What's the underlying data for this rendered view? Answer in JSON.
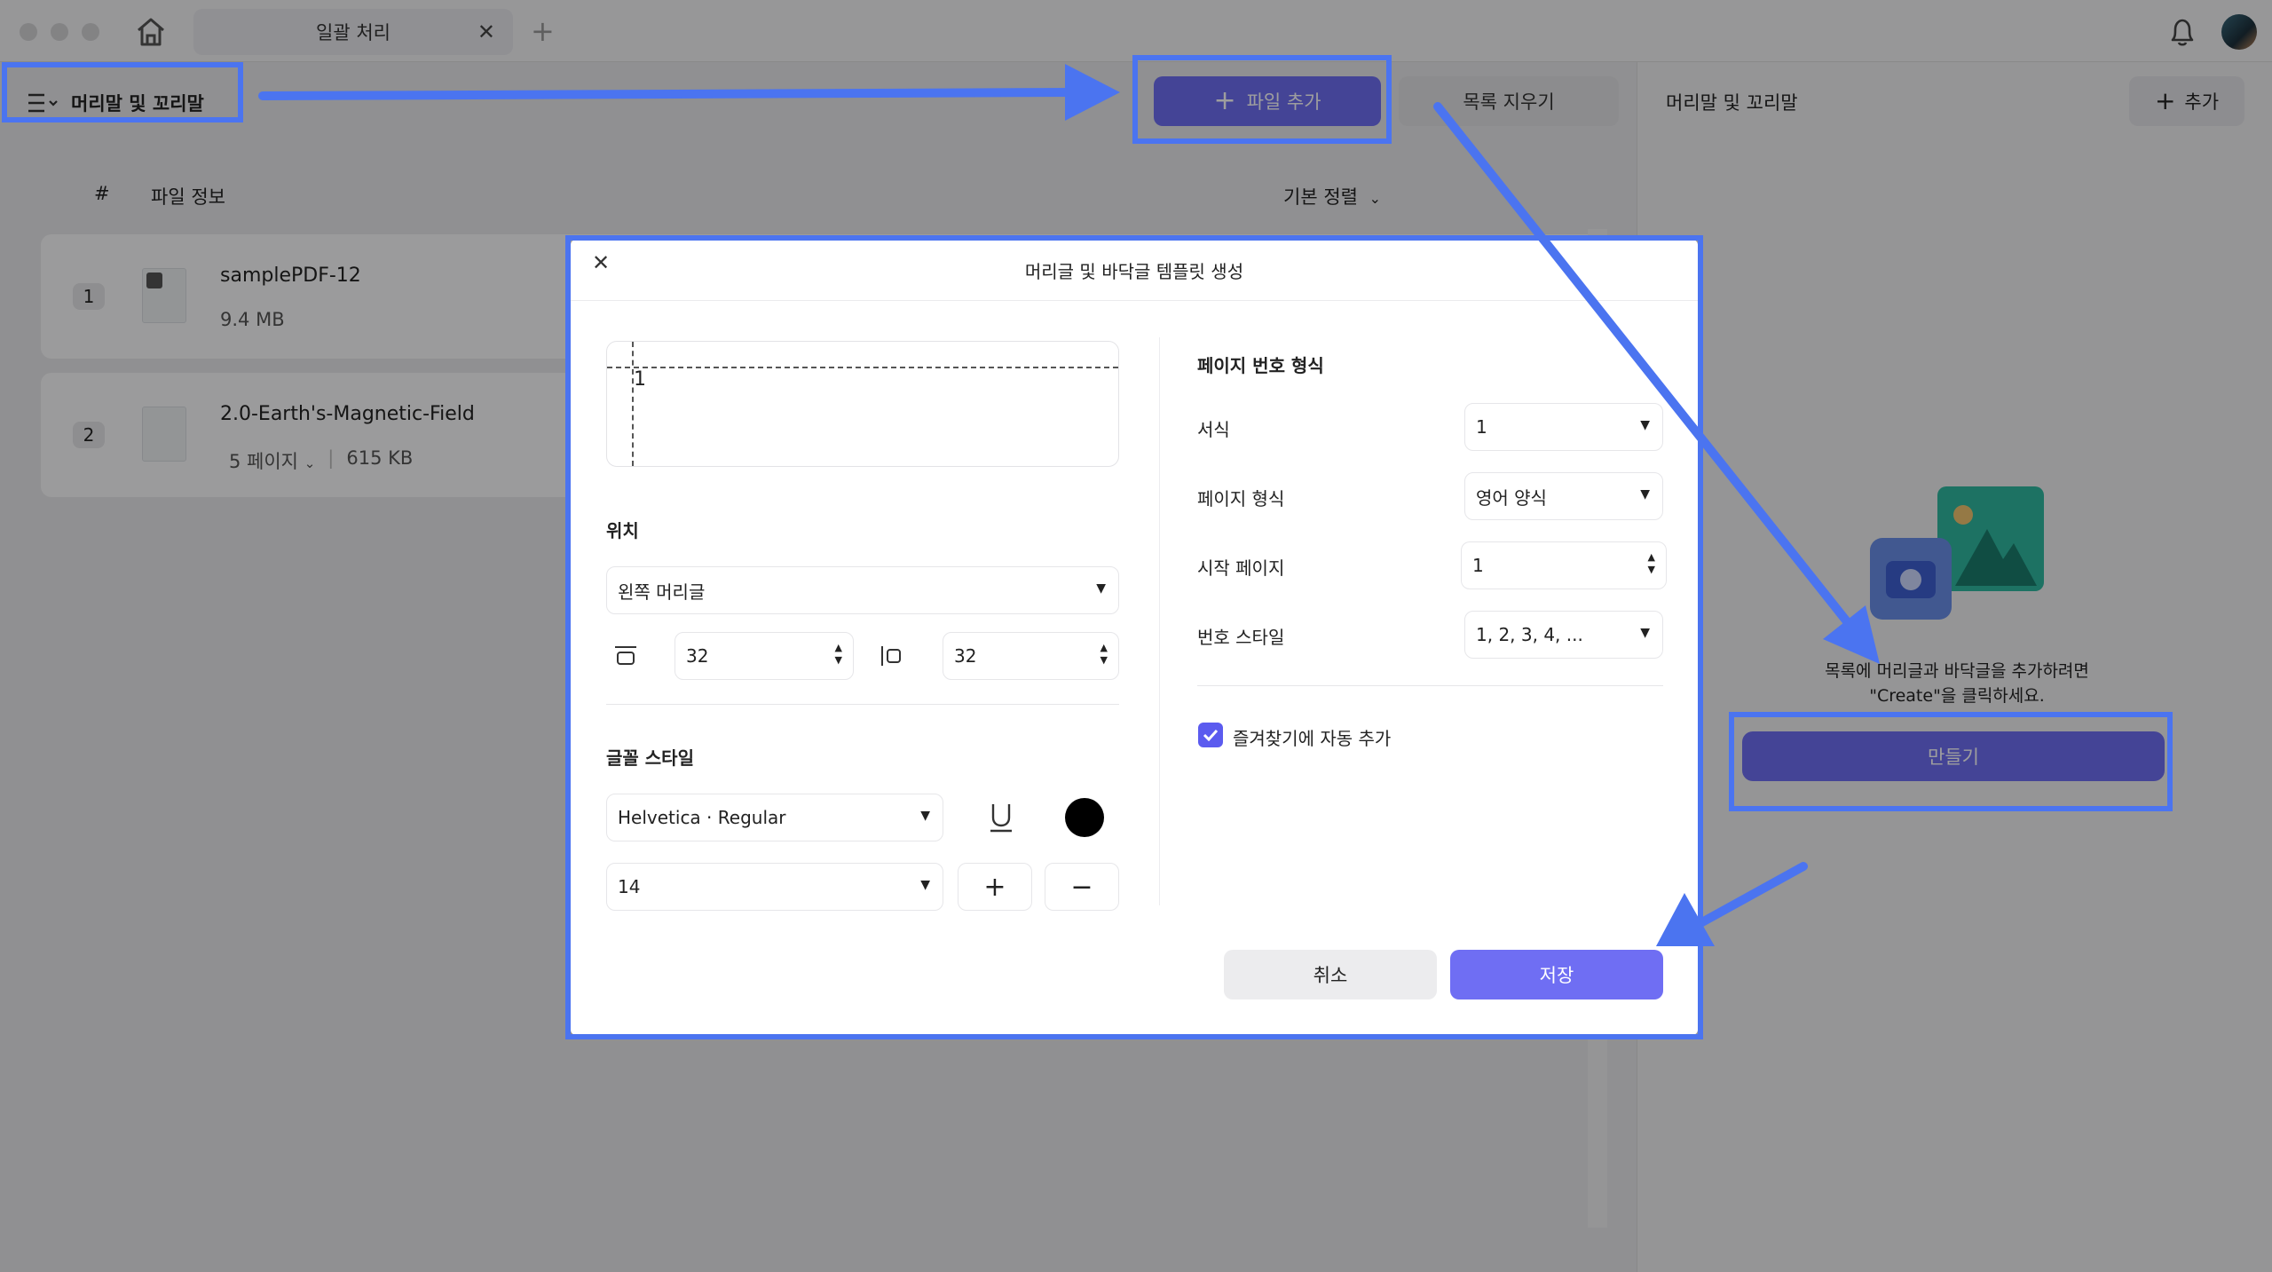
{
  "window": {
    "tab_title": "일괄 처리",
    "tab_close": "✕",
    "tab_add": "+"
  },
  "toolbar": {
    "menu_label": "머리말 및 꼬리말",
    "add_file_label": "파일 추가",
    "clear_list_label": "목록 지우기"
  },
  "file_list": {
    "col_hash": "#",
    "col_info": "파일 정보",
    "sort_label": "기본 정렬",
    "files": [
      {
        "num": "1",
        "name": "samplePDF-12",
        "size": "9.4 MB",
        "pages": ""
      },
      {
        "num": "2",
        "name": "2.0-Earth's-Magnetic-Field",
        "size": "615 KB",
        "pages": "5 페이지"
      }
    ]
  },
  "right_panel": {
    "title": "머리말 및 꼬리말",
    "add_label": "추가",
    "empty_text": "목록에 머리글과 바닥글을 추가하려면\n\"Create\"을 클릭하세요.",
    "create_label": "만들기"
  },
  "dialog": {
    "close": "✕",
    "title": "머리글 및 바닥글 템플릿 생성",
    "preview_number": "1",
    "position_label": "위치",
    "position_value": "왼쪽 머리글",
    "margin_top": "32",
    "margin_side": "32",
    "font_style_label": "글꼴 스타일",
    "font_value": "Helvetica · Regular",
    "font_size": "14",
    "font_color": "#000000",
    "plus": "+",
    "minus": "−",
    "page_number_format_label": "페이지 번호 형식",
    "format_label": "서식",
    "format_value": "1",
    "page_format_label": "페이지 형식",
    "page_format_value": "영어 양식",
    "start_page_label": "시작 페이지",
    "start_page_value": "1",
    "number_style_label": "번호 스타일",
    "number_style_value": "1, 2, 3, 4, ...",
    "auto_add_label": "즐겨찾기에 자동 추가",
    "auto_add_checked": true,
    "cancel_label": "취소",
    "save_label": "저장"
  },
  "colors": {
    "accent": "#6f6ef3",
    "annotation": "#4b74f0"
  }
}
